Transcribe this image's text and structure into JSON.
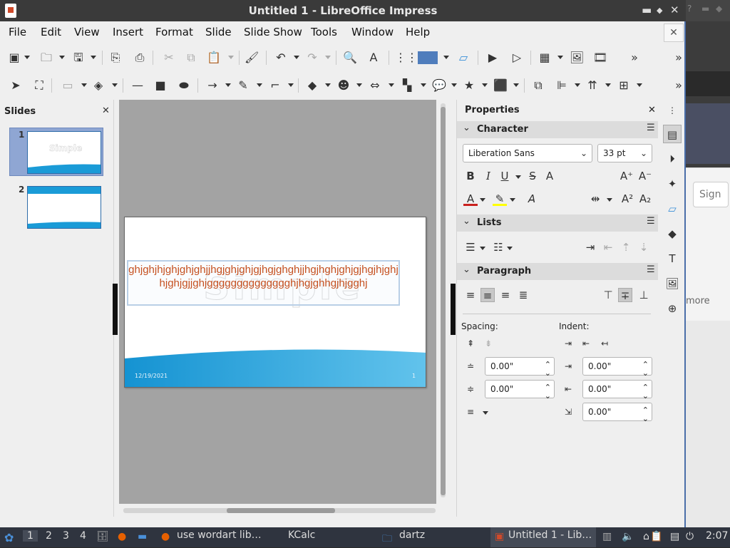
{
  "window": {
    "title": "Untitled 1 - LibreOffice Impress",
    "minimize": "▬",
    "restore": "◆",
    "close": "✕"
  },
  "menubar": {
    "items": [
      "File",
      "Edit",
      "View",
      "Insert",
      "Format",
      "Slide",
      "Slide Show",
      "Tools",
      "Window",
      "Help"
    ],
    "close_doc": "✕"
  },
  "slides_panel": {
    "title": "Slides",
    "close": "✕",
    "thumbs": [
      {
        "number": "1",
        "text": "Simple"
      },
      {
        "number": "2",
        "text": ""
      }
    ]
  },
  "slide": {
    "wordart": "Simple",
    "textbox": "ghjghjhjghjghjghjjhgjghjghjgjhgjghghjjhgjhghjghjgjhgjhjghjhjghjgjjghjgggggggggggggghjhgjghhgjhjgghj",
    "date": "12/19/2021",
    "page": "1",
    "text_color": "#c5501f"
  },
  "properties": {
    "title": "Properties",
    "close": "✕",
    "character": {
      "title": "Character",
      "font_name": "Liberation Sans",
      "font_size": "33 pt"
    },
    "lists": {
      "title": "Lists"
    },
    "paragraph": {
      "title": "Paragraph",
      "spacing_label": "Spacing:",
      "indent_label": "Indent:",
      "above": "0.00\"",
      "below": "0.00\"",
      "before_text": "0.00\"",
      "after_text": "0.00\"",
      "first_line": "0.00\""
    }
  },
  "background_window": {
    "sign_label": "Sign",
    "more_label": "more"
  },
  "taskbar": {
    "workspaces": [
      "1",
      "2",
      "3",
      "4"
    ],
    "tasks": [
      "use wordart lib…",
      "KCalc",
      "dartz",
      "Untitled 1 - Lib…"
    ],
    "clock": "2:07"
  },
  "colors": {
    "accent": "#4a6ea9",
    "wave": "#1a9bd7",
    "text": "#c5501f"
  }
}
